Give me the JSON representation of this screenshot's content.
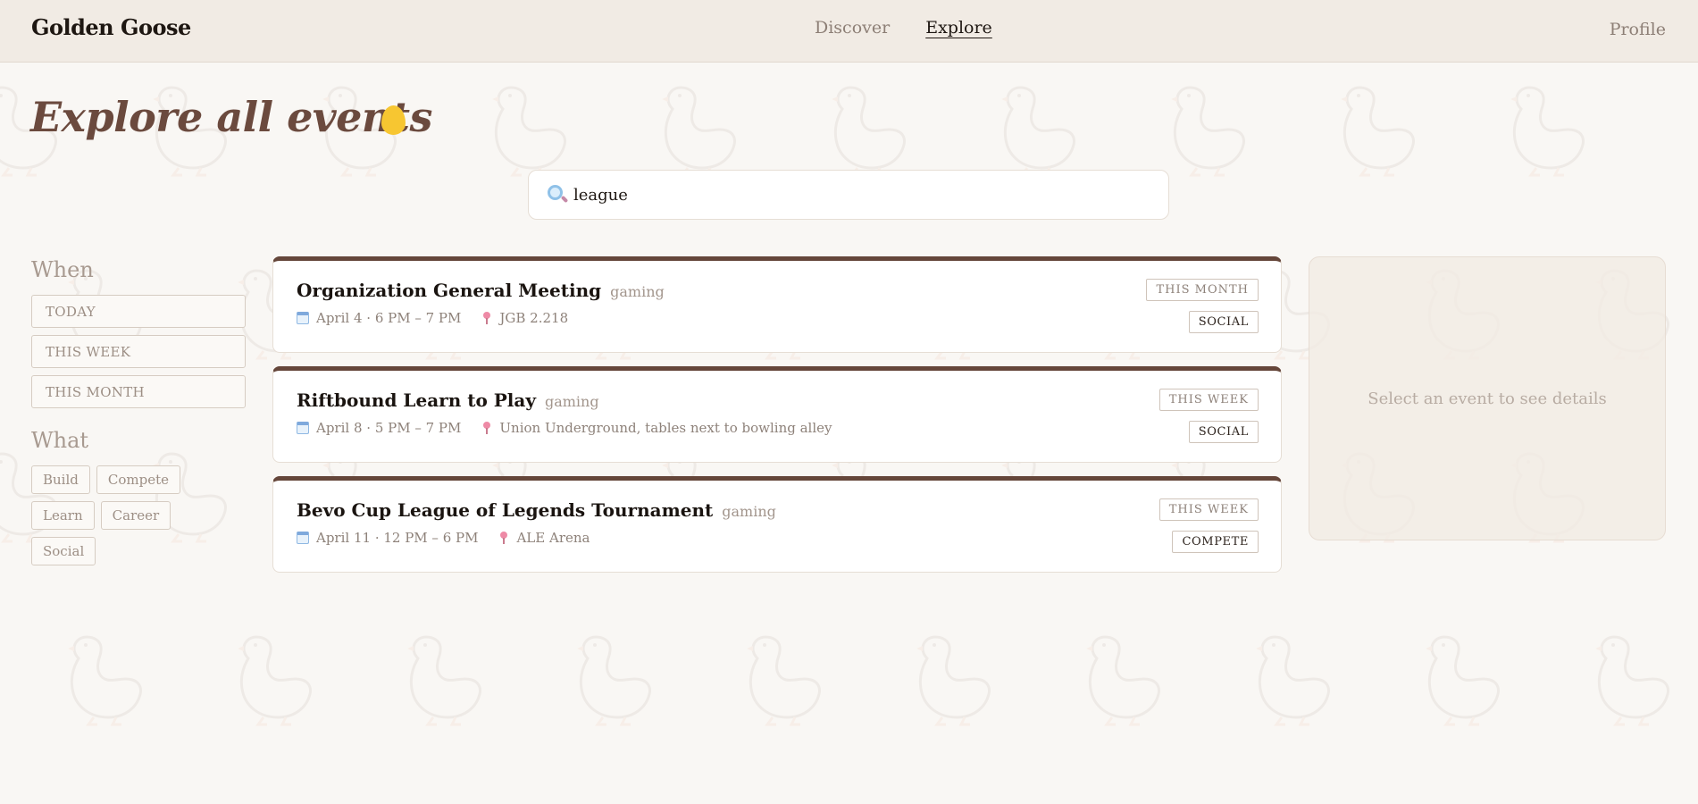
{
  "header": {
    "brand": "Golden Goose",
    "nav": [
      {
        "label": "Discover",
        "active": false
      },
      {
        "label": "Explore",
        "active": true
      }
    ],
    "profile": "Profile"
  },
  "page": {
    "title": "Explore all events"
  },
  "search": {
    "value": "league",
    "icon": "magnifier-icon"
  },
  "filters": {
    "when_heading": "When",
    "when_options": [
      "TODAY",
      "THIS WEEK",
      "THIS MONTH"
    ],
    "what_heading": "What",
    "what_options": [
      "Build",
      "Compete",
      "Learn",
      "Career",
      "Social"
    ]
  },
  "events": [
    {
      "title": "Organization General Meeting",
      "category": "gaming",
      "date": "April 4 · 6 PM – 7 PM",
      "location": "JGB 2.218",
      "time_tag": "THIS MONTH",
      "type_tag": "SOCIAL"
    },
    {
      "title": "Riftbound Learn to Play",
      "category": "gaming",
      "date": "April 8 · 5 PM – 7 PM",
      "location": "Union Underground, tables next to bowling alley",
      "time_tag": "THIS WEEK",
      "type_tag": "SOCIAL"
    },
    {
      "title": "Bevo Cup League of Legends Tournament",
      "category": "gaming",
      "date": "April 11 · 12 PM – 6 PM",
      "location": "ALE Arena",
      "time_tag": "THIS WEEK",
      "type_tag": "COMPETE"
    }
  ],
  "details": {
    "placeholder": "Select an event to see details"
  },
  "colors": {
    "accent_brown": "#65463a",
    "egg_yellow": "#f7c631",
    "header_bg": "#f1ebe4",
    "page_bg": "#f9f7f4"
  }
}
